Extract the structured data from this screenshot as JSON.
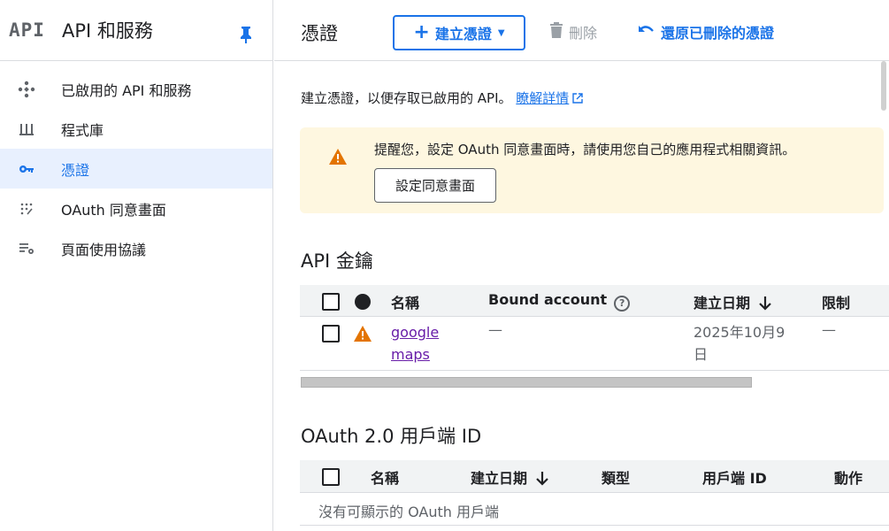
{
  "sidebar": {
    "logo": "API",
    "title": "API 和服務",
    "items": [
      {
        "label": "已啟用的 API 和服務",
        "icon": "diamond-dots-icon"
      },
      {
        "label": "程式庫",
        "icon": "library-icon"
      },
      {
        "label": "憑證",
        "icon": "key-icon"
      },
      {
        "label": "OAuth 同意畫面",
        "icon": "consent-dots-icon"
      },
      {
        "label": "頁面使用協議",
        "icon": "settings-list-icon"
      }
    ],
    "active_index": 2
  },
  "toolbar": {
    "title": "憑證",
    "create_label": "建立憑證",
    "delete_label": "刪除",
    "undo_label": "還原已刪除的憑證"
  },
  "intro": {
    "text": "建立憑證，以便存取已啟用的 API。",
    "link": "瞭解詳情"
  },
  "warning": {
    "text": "提醒您，設定 OAuth 同意畫面時，請使用您自己的應用程式相關資訊。",
    "button": "設定同意畫面"
  },
  "api_keys": {
    "title": "API 金鑰",
    "columns": [
      "名稱",
      "Bound account",
      "建立日期",
      "限制"
    ],
    "rows": [
      {
        "name_line1": "google",
        "name_line2": "maps",
        "bound": "—",
        "date_line1": "2025年10月9",
        "date_line2": "日",
        "restriction": "—"
      }
    ]
  },
  "oauth": {
    "title": "OAuth 2.0 用戶端 ID",
    "columns": [
      "名稱",
      "建立日期",
      "類型",
      "用戶端 ID",
      "動作"
    ],
    "empty": "沒有可顯示的 OAuth 用戶端"
  },
  "colors": {
    "accent": "#1a73e8",
    "warning_bg": "#fef7e0",
    "warning_icon": "#e37400",
    "active_bg": "#e8f0fe",
    "link_visited": "#681da8"
  }
}
